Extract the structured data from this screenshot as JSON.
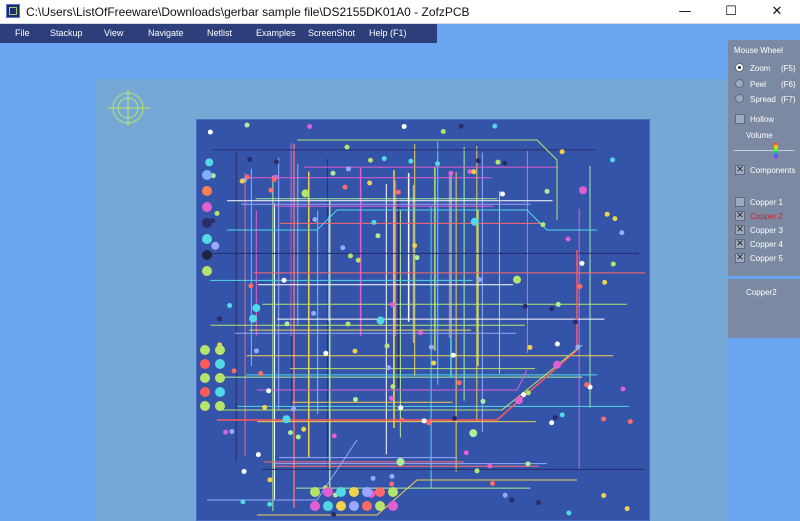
{
  "window": {
    "title": "C:\\Users\\ListOfFreeware\\Downloads\\gerbar sample file\\DS2155DK01A0 - ZofzPCB",
    "minimize": "—",
    "maximize": "☐",
    "close": "✕"
  },
  "menu": {
    "file": "File",
    "stackup": "Stackup",
    "view": "View",
    "navigate": "Navigate",
    "netlist": "Netlist",
    "examples": "Examples",
    "screenshot": "ScreenShot",
    "help": "Help (F1)"
  },
  "panel": {
    "mouse_wheel": "Mouse Wheel",
    "zoom_label": "Zoom",
    "zoom_key": "(F5)",
    "peel_label": "Peel",
    "peel_key": "(F6)",
    "spread_label": "Spread",
    "spread_key": "(F7)",
    "selected_mode": "Zoom",
    "hollow": "Hollow",
    "volume": "Volume",
    "components": "Components",
    "copper1": "Copper 1",
    "copper2": "Copper 2",
    "copper3": "Copper 3",
    "copper4": "Copper 4",
    "copper5": "Copper 5",
    "current_layer": "Copper2",
    "colors": {
      "active_layer": "#d0202a",
      "panel": "#7b8aa2"
    }
  }
}
